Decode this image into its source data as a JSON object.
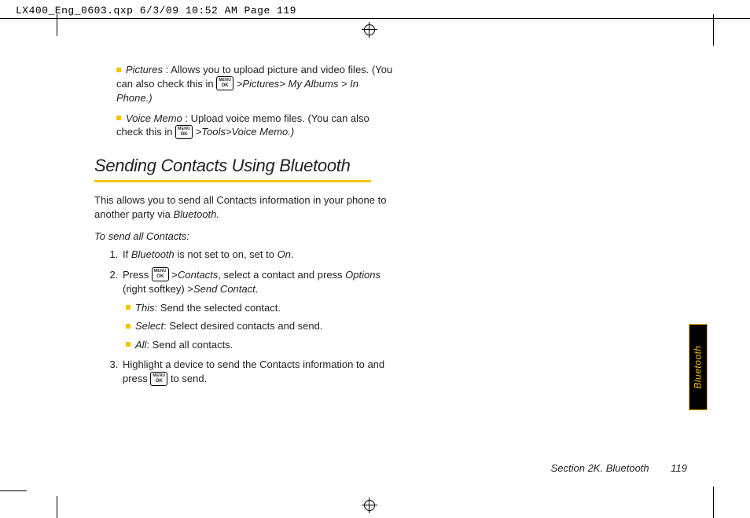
{
  "header_line": "LX400_Eng_0603.qxp  6/3/09  10:52 AM  Page 119",
  "top_items": [
    {
      "term": "Pictures",
      "after_term": " : Allows you to upload picture and video files. (You can also check this in ",
      "menu_path": [
        ">Pictures>",
        "My Albums > In Phone.)"
      ]
    },
    {
      "term": "Voice Memo",
      "after_term": " : Upload voice memo files. (You can also check this in ",
      "menu_path": [
        ">Tools>Voice Memo.)"
      ]
    }
  ],
  "section_title": "Sending Contacts Using Bluetooth",
  "intro_line_1": "This allows you to send all Contacts information in your phone to another party via ",
  "intro_italic": "Bluetooth.",
  "subhead": "To send all Contacts:",
  "step1_a": "If ",
  "step1_italic1": "Bluetooth",
  "step1_b": " is not set to on, set to ",
  "step1_italic2": "On",
  "step1_c": ".",
  "step2_a": "Press ",
  "step2_b": " >",
  "step2_italic1": "Contacts",
  "step2_c": ", select a contact and press ",
  "step2_italic2": "Options",
  "step2_d": " (right softkey) >",
  "step2_italic3": "Send Contact",
  "step2_e": ".",
  "step2_opts": [
    {
      "term": "This",
      "desc": ": Send the selected contact."
    },
    {
      "term": "Select",
      "desc": ": Select desired contacts and send."
    },
    {
      "term": "All",
      "desc": ": Send all contacts."
    }
  ],
  "step3_a": "Highlight a device to send the Contacts information to and press ",
  "step3_b": " to send.",
  "side_tab": "Bluetooth",
  "footer_section": "Section 2K. Bluetooth",
  "footer_page": "119",
  "menu_key_l1": "MENU",
  "menu_key_l2": "OK"
}
